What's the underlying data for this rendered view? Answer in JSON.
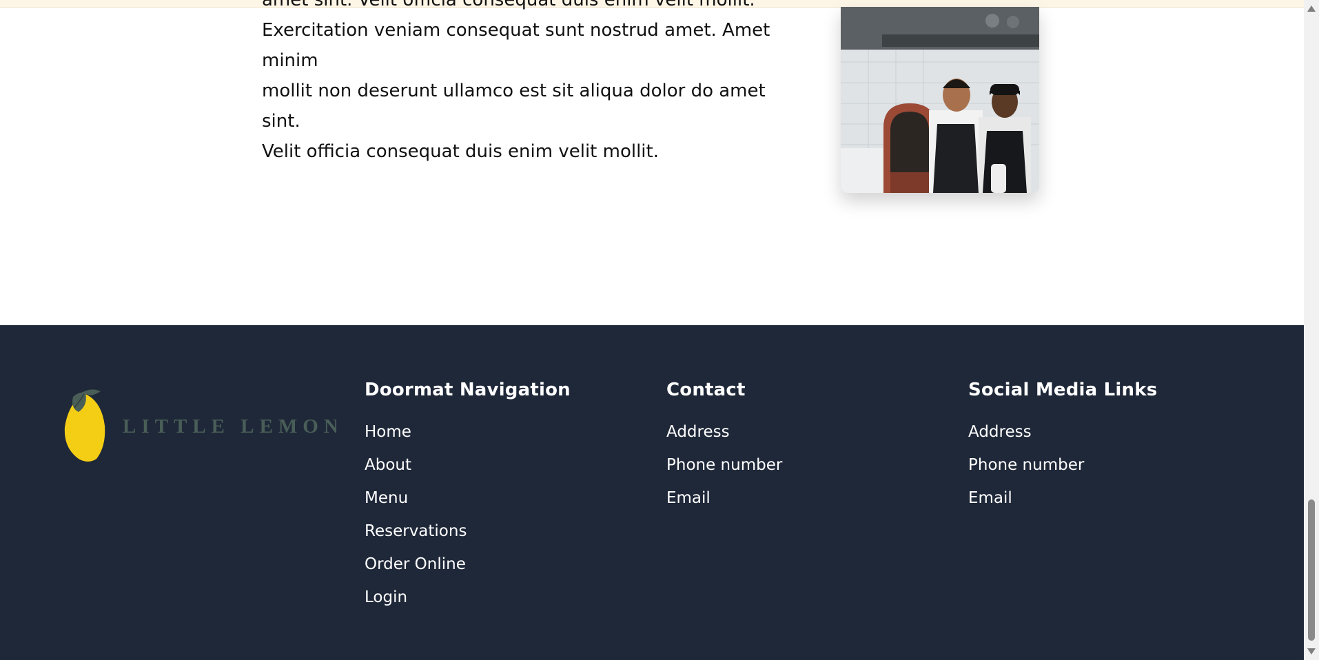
{
  "about": {
    "partial_line": "amet sint. Velit officia consequat duis enim velit mollit.",
    "lines": [
      "Exercitation veniam consequat sunt nostrud amet. Amet minim",
      "mollit non deserunt ullamco est sit aliqua dolor do amet sint.",
      "Velit officia consequat duis enim velit mollit."
    ]
  },
  "footer": {
    "logo_text": "LITTLE LEMON",
    "nav": {
      "heading": "Doormat Navigation",
      "items": [
        "Home",
        "About",
        "Menu",
        "Reservations",
        "Order Online",
        "Login"
      ]
    },
    "contact": {
      "heading": "Contact",
      "items": [
        "Address",
        "Phone number",
        "Email"
      ]
    },
    "social": {
      "heading": "Social Media Links",
      "items": [
        "Address",
        "Phone number",
        "Email"
      ]
    }
  },
  "colors": {
    "footer_bg": "#1f2839",
    "lemon": "#f4ce14",
    "logo_text": "#495e57"
  }
}
